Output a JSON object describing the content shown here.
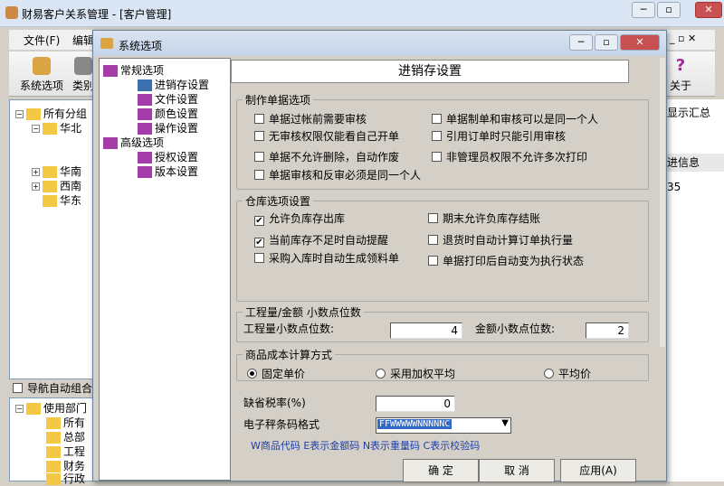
{
  "main": {
    "title": "财易客户关系管理 - [客户管理]",
    "menu": [
      "文件(F)",
      "编辑"
    ],
    "tools": [
      "系统选项",
      "类别",
      "关于"
    ],
    "tree": [
      "所有分组",
      "华北",
      "华南",
      "西南",
      "华东"
    ],
    "nav_checkbox": "导航自动组合",
    "tree2": [
      "使用部门",
      "所有",
      "总部",
      "工程",
      "财务",
      "行政"
    ],
    "right": [
      "显示汇总",
      "进信息",
      "35"
    ]
  },
  "dialog": {
    "title": "系统选项",
    "tree": {
      "general": "常规选项",
      "items1": [
        "进销存设置",
        "文件设置",
        "颜色设置",
        "操作设置"
      ],
      "advanced": "高级选项",
      "items2": [
        "授权设置",
        "版本设置"
      ]
    },
    "header": "进销存设置",
    "doc": {
      "legend": "制作单据选项",
      "items": [
        {
          "label": "单据过帐前需要审核",
          "checked": false
        },
        {
          "label": "单据制单和审核可以是同一个人",
          "checked": false
        },
        {
          "label": "无审核权限仅能看自己开单",
          "checked": false
        },
        {
          "label": "引用订单时只能引用审核",
          "checked": false
        },
        {
          "label": "单据不允许删除，自动作废",
          "checked": false
        },
        {
          "label": "非管理员权限不允许多次打印",
          "checked": false
        },
        {
          "label": "单据审核和反审必须是同一个人",
          "checked": false
        }
      ]
    },
    "stock": {
      "legend": "仓库选项设置",
      "items": [
        {
          "label": "允许负库存出库",
          "checked": true
        },
        {
          "label": "期末允许负库存结账",
          "checked": false
        },
        {
          "label": "当前库存不足时自动提醒",
          "checked": true
        },
        {
          "label": "退货时自动计算订单执行量",
          "checked": false
        },
        {
          "label": "采购入库时自动生成领料单",
          "checked": false
        },
        {
          "label": "单据打印后自动变为执行状态",
          "checked": false
        }
      ]
    },
    "decimal": {
      "legend": "工程量/金额 小数点位数",
      "qty_label": "工程量小数点位数:",
      "qty": "4",
      "amt_label": "金额小数点位数:",
      "amt": "2"
    },
    "cost": {
      "legend": "商品成本计算方式",
      "options": [
        "固定单价",
        "采用加权平均",
        "平均价"
      ],
      "selected": 0
    },
    "tax_label": "缺省税率(%)",
    "tax": "0",
    "barcode_label": "电子秤条码格式",
    "barcode": "FFWWWWWNNNNNC",
    "hint": "W商品代码 E表示金额码 N表示重量码 C表示校验码",
    "buttons": [
      "确  定",
      "取  消",
      "应用(A)"
    ]
  }
}
